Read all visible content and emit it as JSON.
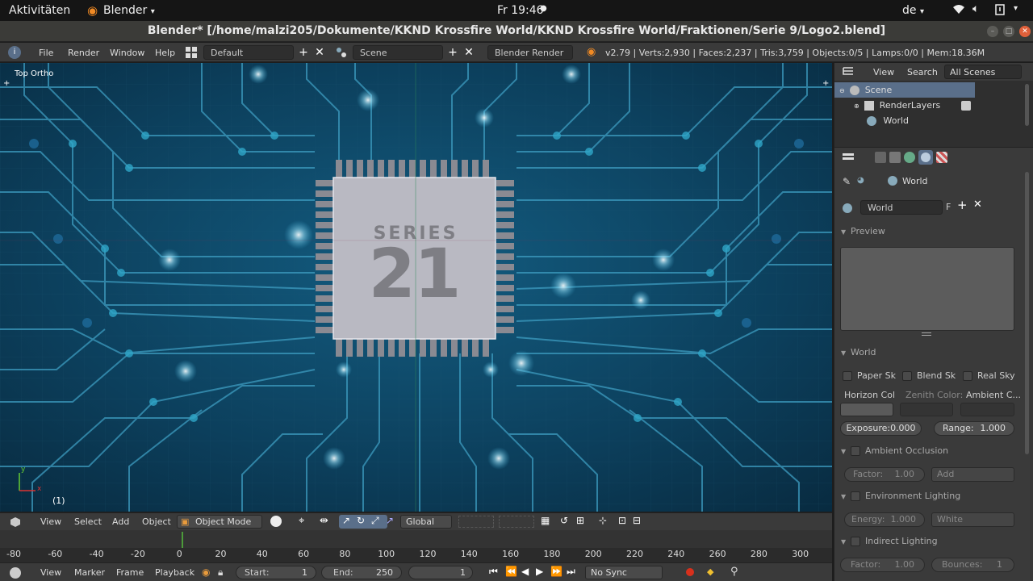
{
  "system_bar": {
    "activities": "Aktivitäten",
    "app_name": "Blender",
    "clock": "Fr 19:46",
    "lang": "de"
  },
  "window": {
    "title": "Blender* [/home/malzi205/Dokumente/KKND Krossfire World/KKND Krossfire World/Fraktionen/Serie 9/Logo2.blend]"
  },
  "info_header": {
    "menus": [
      "File",
      "Render",
      "Window",
      "Help"
    ],
    "layout": "Default",
    "scene": "Scene",
    "engine": "Blender Render",
    "stats": "v2.79 | Verts:2,930 | Faces:2,237 | Tris:3,759 | Objects:0/5 | Lamps:0/0 | Mem:18.36M"
  },
  "viewport": {
    "view_name": "Top Ortho",
    "frame_indicator": "(1)",
    "chip_text_top": "SERIES",
    "chip_text_big": "21",
    "axis_x": "x",
    "axis_y": "y",
    "colors": {
      "bg": "#0c3e5a",
      "chip": "#b9b9c2",
      "chip_text": "#7e7e84",
      "trace": "#6dc8e0"
    }
  },
  "view3d_header": {
    "menus": [
      "View",
      "Select",
      "Add",
      "Object"
    ],
    "mode": "Object Mode",
    "orientation": "Global"
  },
  "timeline": {
    "ticks": [
      "-80",
      "-60",
      "-40",
      "-20",
      "0",
      "20",
      "40",
      "60",
      "80",
      "100",
      "120",
      "140",
      "160",
      "180",
      "200",
      "220",
      "240",
      "260",
      "280",
      "300"
    ],
    "menus": [
      "View",
      "Marker",
      "Frame",
      "Playback"
    ],
    "start_label": "Start:",
    "start_value": "1",
    "end_label": "End:",
    "end_value": "250",
    "current_frame": "1",
    "sync": "No Sync"
  },
  "outliner": {
    "view": "View",
    "search": "Search",
    "filter": "All Scenes",
    "items": [
      "Scene",
      "RenderLayers",
      "World"
    ]
  },
  "properties": {
    "breadcrumb": "World",
    "world_name": "World",
    "fake_user": "F",
    "preview_label": "Preview",
    "world_panel": "World",
    "paper_sky": "Paper Sk",
    "blend_sky": "Blend Sk",
    "real_sky": "Real Sky",
    "horizon_color": "Horizon Col",
    "zenith_color": "Zenith Color:",
    "ambient_color": "Ambient C...",
    "exposure": "Exposure:0.000",
    "range_label": "Range:",
    "range_value": "1.000",
    "ao_panel": "Ambient Occlusion",
    "ao_factor_label": "Factor:",
    "ao_factor_value": "1.00",
    "ao_mode": "Add",
    "env_panel": "Environment Lighting",
    "env_energy_label": "Energy:",
    "env_energy_value": "1.000",
    "env_color": "White",
    "indirect_panel": "Indirect Lighting",
    "ind_factor_label": "Factor:",
    "ind_factor_value": "1.00",
    "ind_bounces_label": "Bounces:",
    "ind_bounces_value": "1"
  }
}
